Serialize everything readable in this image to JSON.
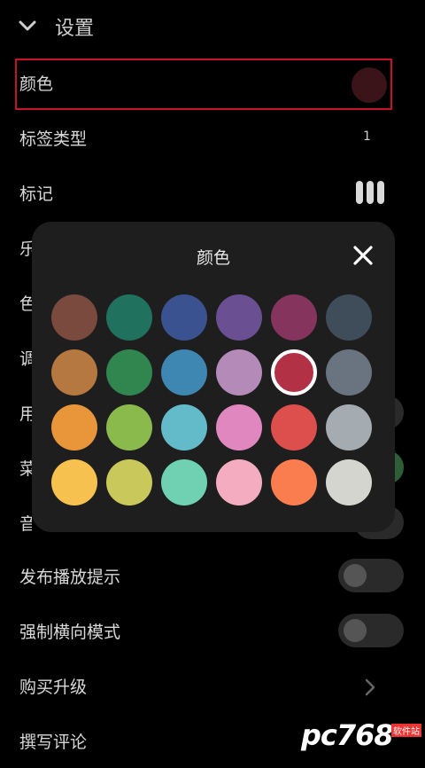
{
  "header": {
    "title": "设置"
  },
  "settings": {
    "color_label": "颜色",
    "color_value": "#3a1418",
    "tag_type_label": "标签类型",
    "tag_type_value": "1",
    "mark_label": "标记",
    "publish_hint_label": "发布播放提示",
    "force_landscape_label": "强制横向模式",
    "buy_upgrade_label": "购买升级",
    "write_review_label": "撰写评论",
    "hidden_labels": [
      "乐",
      "色",
      "调",
      "用",
      "菜",
      "音"
    ]
  },
  "dialog": {
    "title": "颜色",
    "colors": [
      [
        "#7b4a3f",
        "#21715f",
        "#3a5290",
        "#6a5092",
        "#85345e",
        "#3f4c5a"
      ],
      [
        "#b57840",
        "#31854e",
        "#3d87b2",
        "#b48ab9",
        "#b23145",
        "#6a7380"
      ],
      [
        "#e9963b",
        "#8ab94c",
        "#63bac8",
        "#e087bf",
        "#dc4f4d",
        "#a4acb2"
      ],
      [
        "#f6c14f",
        "#c9c95b",
        "#6fd0b2",
        "#f4adc0",
        "#fa7d4f",
        "#d5d5cf"
      ]
    ],
    "selected_row": 1,
    "selected_col": 4
  },
  "watermark": {
    "brand": "pc768",
    "site": "软件站"
  }
}
